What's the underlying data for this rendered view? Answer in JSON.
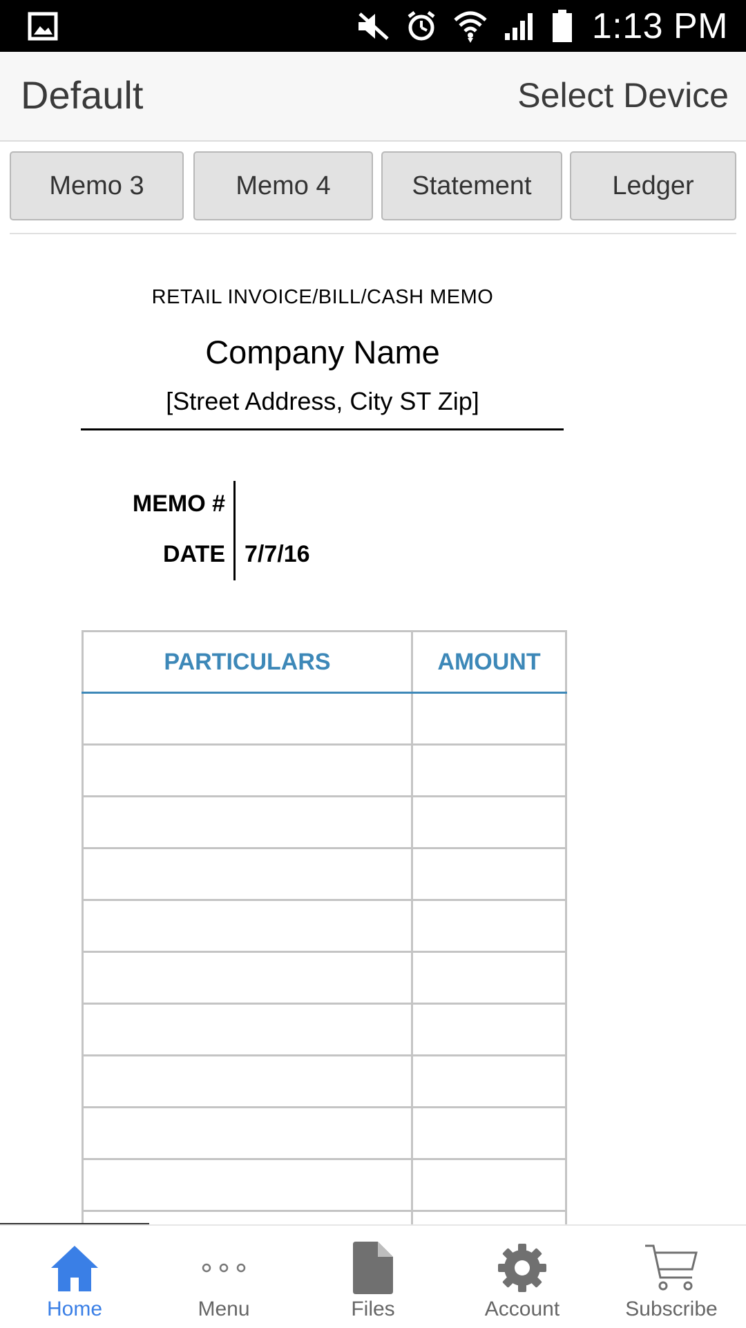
{
  "status_bar": {
    "time": "1:13 PM",
    "icons": [
      "gallery-icon",
      "mute-icon",
      "alarm-icon",
      "wifi-icon",
      "signal-icon",
      "battery-icon"
    ]
  },
  "app_bar": {
    "title": "Default",
    "action_label": "Select Device"
  },
  "tabs": [
    {
      "label": "Memo 3"
    },
    {
      "label": "Memo 4"
    },
    {
      "label": "Statement"
    },
    {
      "label": "Ledger"
    }
  ],
  "document": {
    "type_title": "RETAIL INVOICE/BILL/CASH MEMO",
    "company_name": "Company Name",
    "address": "[Street Address, City ST Zip]",
    "memo_label": "MEMO #",
    "memo_value": "",
    "date_label": "DATE",
    "date_value": "7/7/16",
    "table": {
      "columns": [
        "PARTICULARS",
        "AMOUNT"
      ],
      "header_color": "#3d88b8"
    }
  },
  "bottom_nav": {
    "active_color": "#3a7fe6",
    "items": [
      {
        "label": "Home",
        "icon": "home-icon",
        "active": true
      },
      {
        "label": "Menu",
        "icon": "more-dots-icon",
        "active": false
      },
      {
        "label": "Files",
        "icon": "file-icon",
        "active": false
      },
      {
        "label": "Account",
        "icon": "gear-icon",
        "active": false
      },
      {
        "label": "Subscribe",
        "icon": "cart-icon",
        "active": false
      }
    ]
  }
}
